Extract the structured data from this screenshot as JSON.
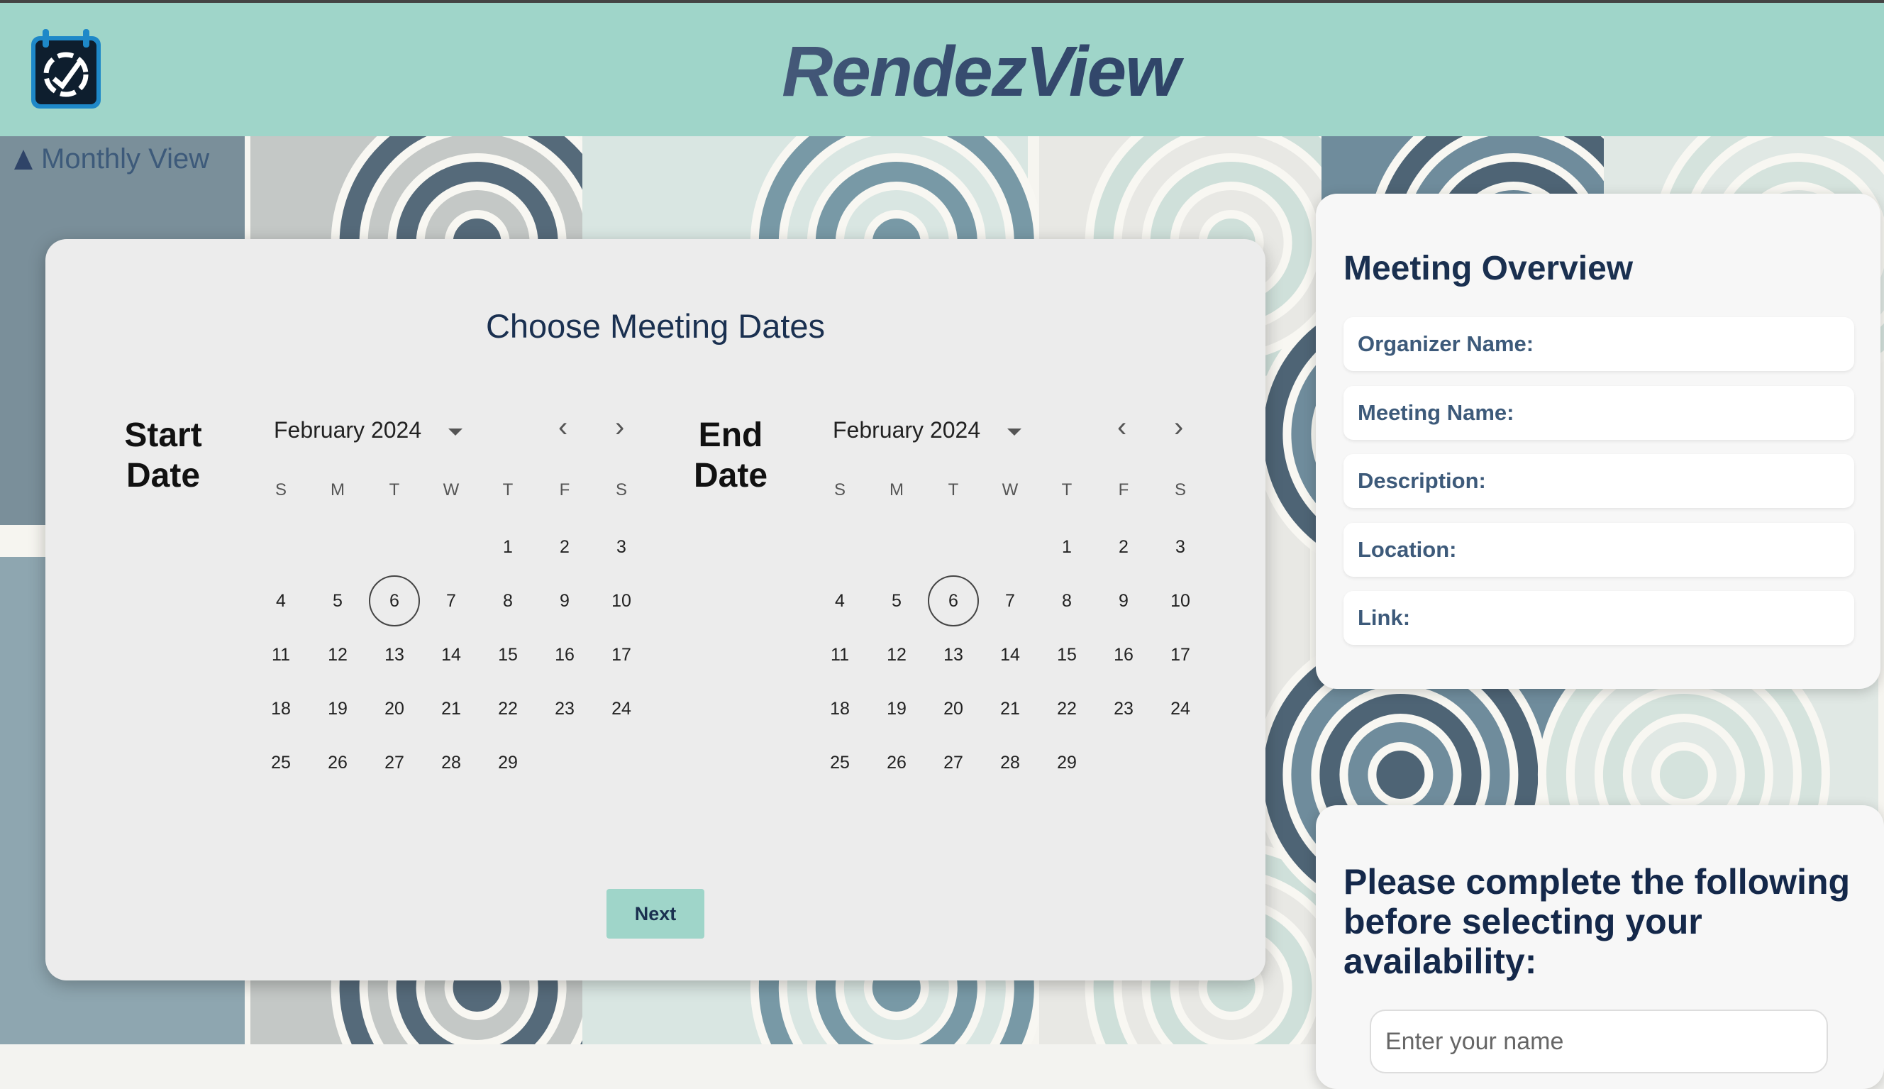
{
  "header": {
    "app_title": "RendezView",
    "logo_icon": "calendar-compass-icon",
    "bg_color": "#9fd5c9"
  },
  "nav": {
    "monthly_view": "Monthly View"
  },
  "dates_card": {
    "title": "Choose Meeting Dates",
    "start_label": [
      "Start",
      "Date"
    ],
    "end_label": [
      "End",
      "Date"
    ],
    "next_button": "Next",
    "calendars": [
      {
        "month": "February 2024",
        "selected": 6
      },
      {
        "month": "February 2024",
        "selected": 6
      }
    ],
    "weekdays": [
      "S",
      "M",
      "T",
      "W",
      "T",
      "F",
      "S"
    ],
    "first_weekday": 4,
    "days_in_month": 29
  },
  "overview": {
    "title": "Meeting Overview",
    "fields": [
      "Organizer Name:",
      "Meeting Name:",
      "Description:",
      "Location:",
      "Link:"
    ]
  },
  "availability": {
    "title": "Please complete the following before selecting your availability:",
    "name_placeholder": "Enter your name"
  },
  "colors": {
    "accent": "#9fd5c9",
    "heading": "#1a3050",
    "label": "#3d5a7a"
  }
}
